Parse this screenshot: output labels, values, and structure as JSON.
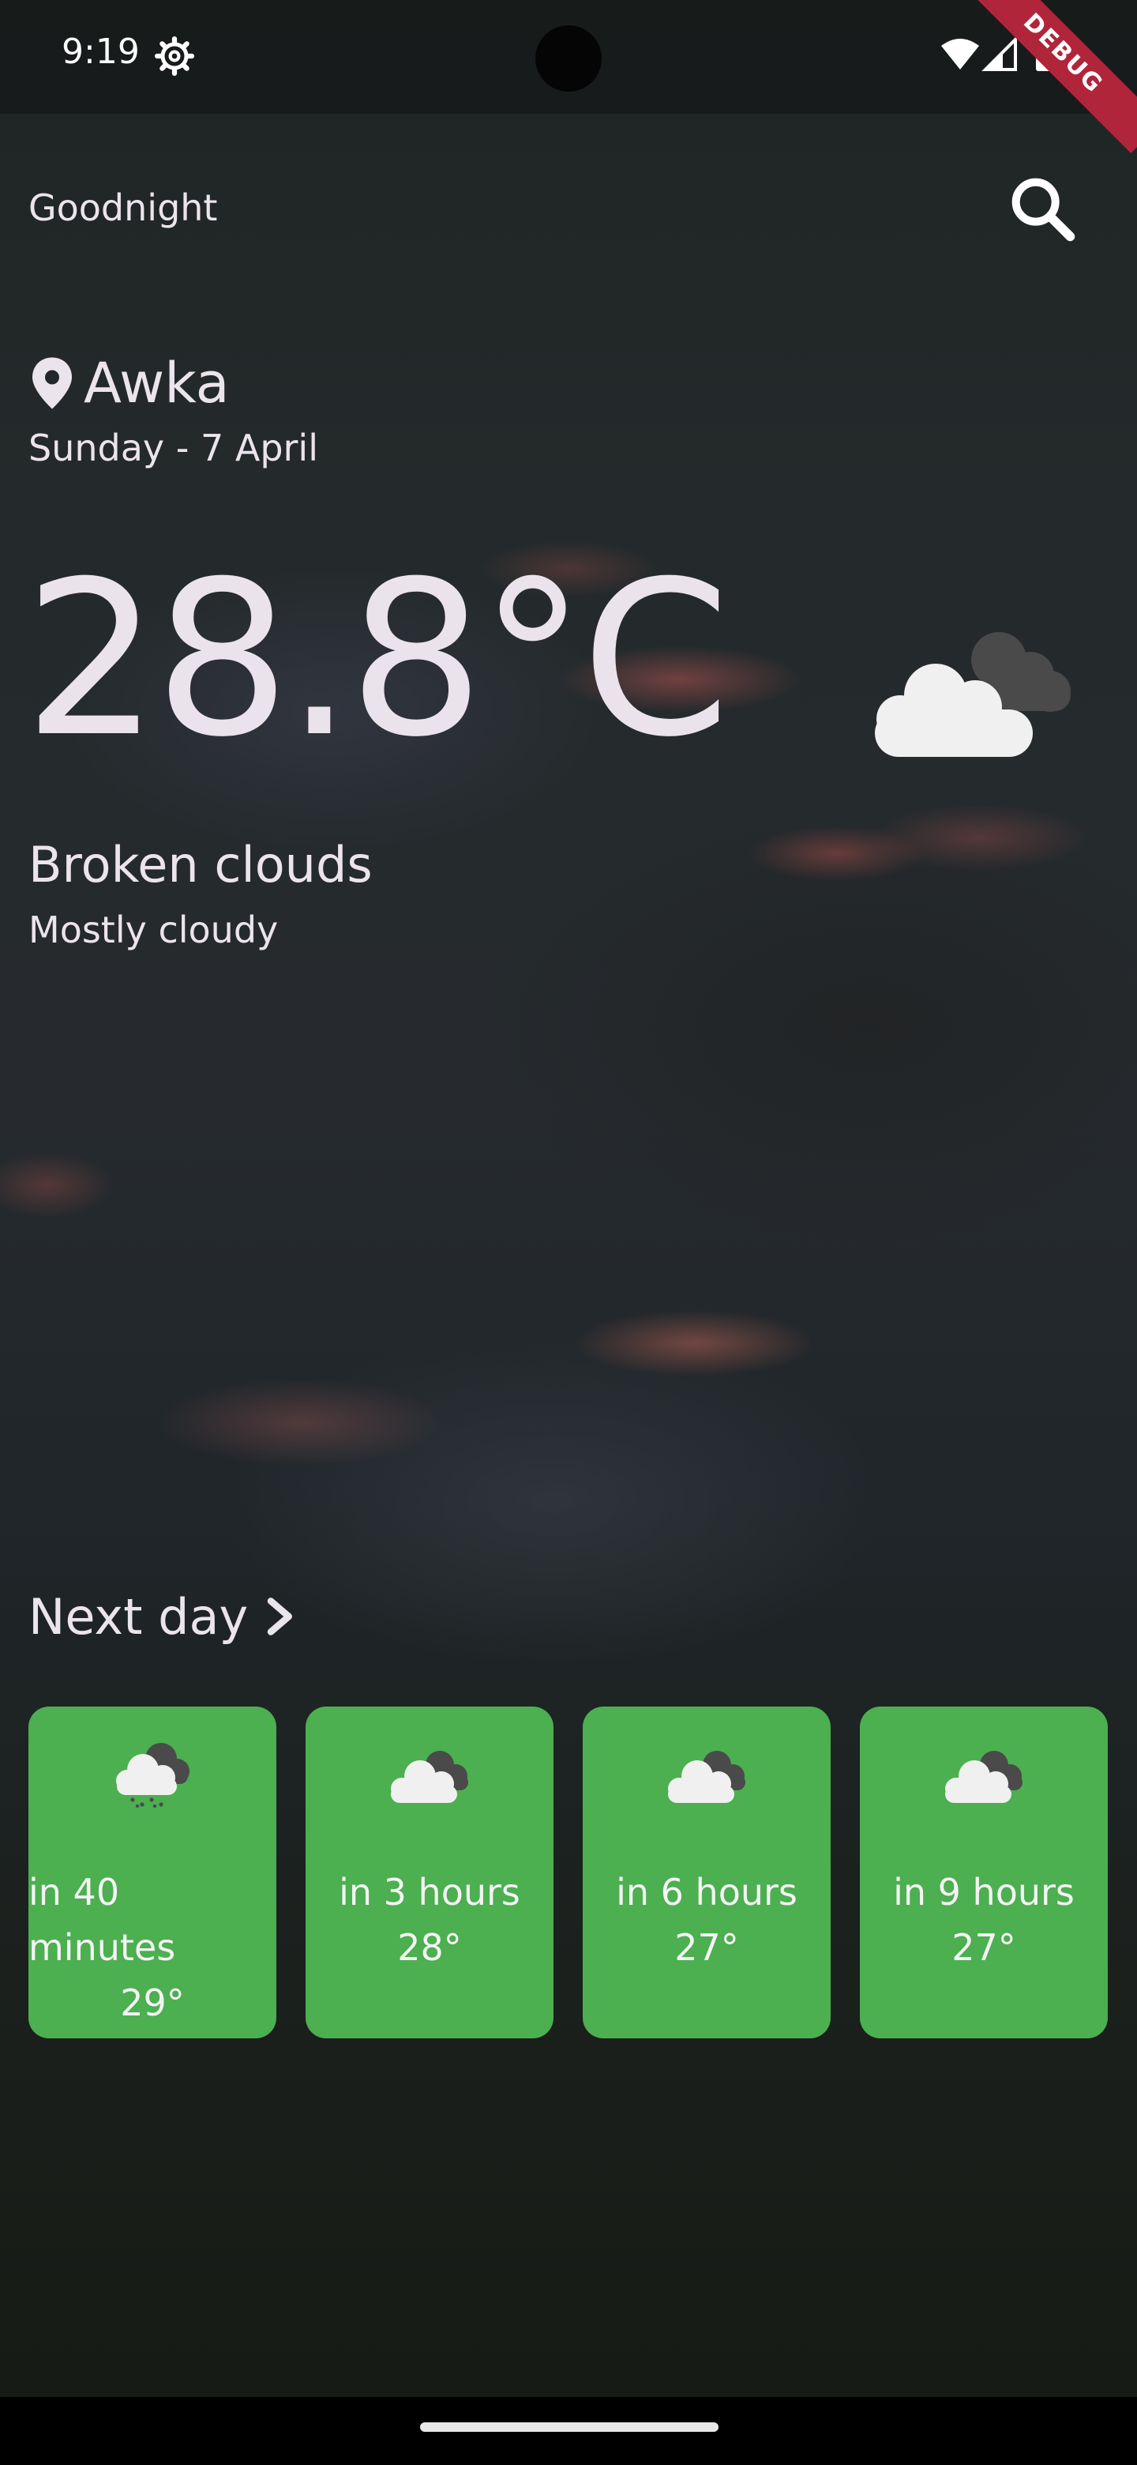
{
  "status_bar": {
    "time": "9:19",
    "debug_label": "DEBUG"
  },
  "header": {
    "greeting": "Goodnight"
  },
  "location": {
    "city": "Awka",
    "date": "Sunday - 7 April"
  },
  "current": {
    "temperature": "28.8°C",
    "condition": "Broken clouds",
    "summary": "Mostly cloudy",
    "icon": "broken-clouds-icon"
  },
  "forecast": {
    "title": "Next day",
    "cards": [
      {
        "time": "in 40 minutes",
        "temp": "29°",
        "icon": "rain-cloud-icon"
      },
      {
        "time": "in 3 hours",
        "temp": "28°",
        "icon": "broken-clouds-icon"
      },
      {
        "time": "in 6 hours",
        "temp": "27°",
        "icon": "broken-clouds-icon"
      },
      {
        "time": "in 9 hours",
        "temp": "27°",
        "icon": "broken-clouds-icon"
      }
    ]
  },
  "colors": {
    "card": "#4caf50",
    "debug_banner": "#b0253a",
    "text": "#ece4ec"
  }
}
